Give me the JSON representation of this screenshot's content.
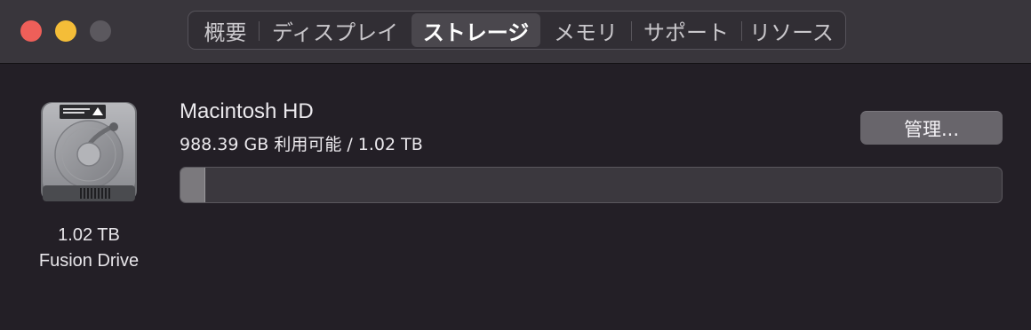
{
  "window": {
    "traffic_lights": {
      "close_color": "#ee5f59",
      "minimize_color": "#f4bd38",
      "zoom_color": "#5b585e"
    }
  },
  "tabs": [
    {
      "label": "概要",
      "active": false
    },
    {
      "label": "ディスプレイ",
      "active": false
    },
    {
      "label": "ストレージ",
      "active": true
    },
    {
      "label": "メモリ",
      "active": false
    },
    {
      "label": "サポート",
      "active": false
    },
    {
      "label": "リソース",
      "active": false
    }
  ],
  "drive": {
    "icon": "hard-drive-icon",
    "size": "1.02 TB",
    "type": "Fusion Drive"
  },
  "disk": {
    "name": "Macintosh HD",
    "availability": "988.39 GB 利用可能 / 1.02 TB",
    "used_fraction": 0.03,
    "used_color": "#7b797d",
    "free_color": "#3b383e"
  },
  "manage_button": {
    "label": "管理..."
  }
}
